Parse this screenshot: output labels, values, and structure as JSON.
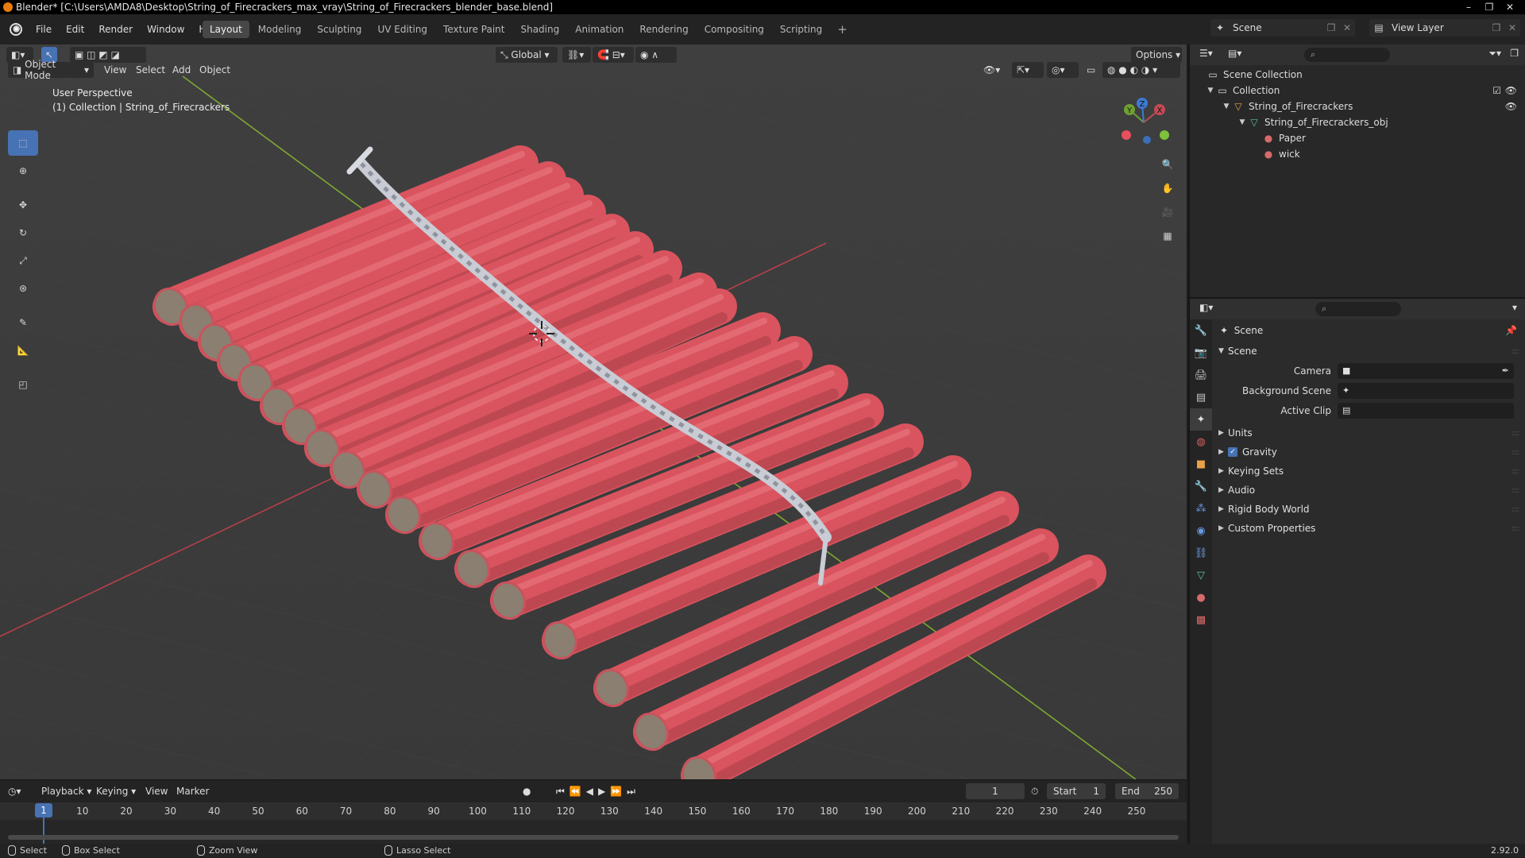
{
  "window": {
    "title": "Blender* [C:\\Users\\AMDA8\\Desktop\\String_of_Firecrackers_max_vray\\String_of_Firecrackers_blender_base.blend]",
    "minimize": "–",
    "maximize": "❐",
    "close": "✕"
  },
  "menu": {
    "items": [
      "File",
      "Edit",
      "Render",
      "Window",
      "Help"
    ]
  },
  "workspaces": {
    "tabs": [
      "Layout",
      "Modeling",
      "Sculpting",
      "UV Editing",
      "Texture Paint",
      "Shading",
      "Animation",
      "Rendering",
      "Compositing",
      "Scripting"
    ],
    "active": "Layout",
    "add": "+"
  },
  "scene_selector": {
    "value": "Scene"
  },
  "view_layer_selector": {
    "value": "View Layer"
  },
  "viewport": {
    "transform_orientation": "Global",
    "options_label": "Options",
    "mode": "Object Mode",
    "menus": [
      "View",
      "Select",
      "Add",
      "Object"
    ],
    "info_line1": "User Perspective",
    "info_line2": "(1) Collection | String_of_Firecrackers",
    "gizmo": {
      "x": "X",
      "y": "Y",
      "z": "Z"
    },
    "colors": {
      "background": "#3d3d3d",
      "paper": "#d9545e",
      "axis_x": "#b5404a",
      "axis_y": "#7fa832"
    }
  },
  "timeline": {
    "menus": [
      "Playback",
      "Keying",
      "View",
      "Marker"
    ],
    "current_frame": "1",
    "start_label": "Start",
    "start": "1",
    "end_label": "End",
    "end": "250",
    "ruler": [
      "1",
      "10",
      "20",
      "30",
      "40",
      "50",
      "60",
      "70",
      "80",
      "90",
      "100",
      "110",
      "120",
      "130",
      "140",
      "150",
      "160",
      "170",
      "180",
      "190",
      "200",
      "210",
      "220",
      "230",
      "240",
      "250"
    ]
  },
  "statusbar": {
    "select": "Select",
    "box_select": "Box Select",
    "zoom_view": "Zoom View",
    "lasso_select": "Lasso Select",
    "version": "2.92.0"
  },
  "outliner": {
    "rows": [
      {
        "label": "Scene Collection"
      },
      {
        "label": "Collection"
      },
      {
        "label": "String_of_Firecrackers"
      },
      {
        "label": "String_of_Firecrackers_obj"
      },
      {
        "label": "Paper"
      },
      {
        "label": "wick"
      }
    ]
  },
  "properties": {
    "context": "Scene",
    "panel_scene": "Scene",
    "camera_label": "Camera",
    "background_scene_label": "Background Scene",
    "active_clip_label": "Active Clip",
    "panels": [
      "Units",
      "Gravity",
      "Keying Sets",
      "Audio",
      "Rigid Body World",
      "Custom Properties"
    ]
  }
}
